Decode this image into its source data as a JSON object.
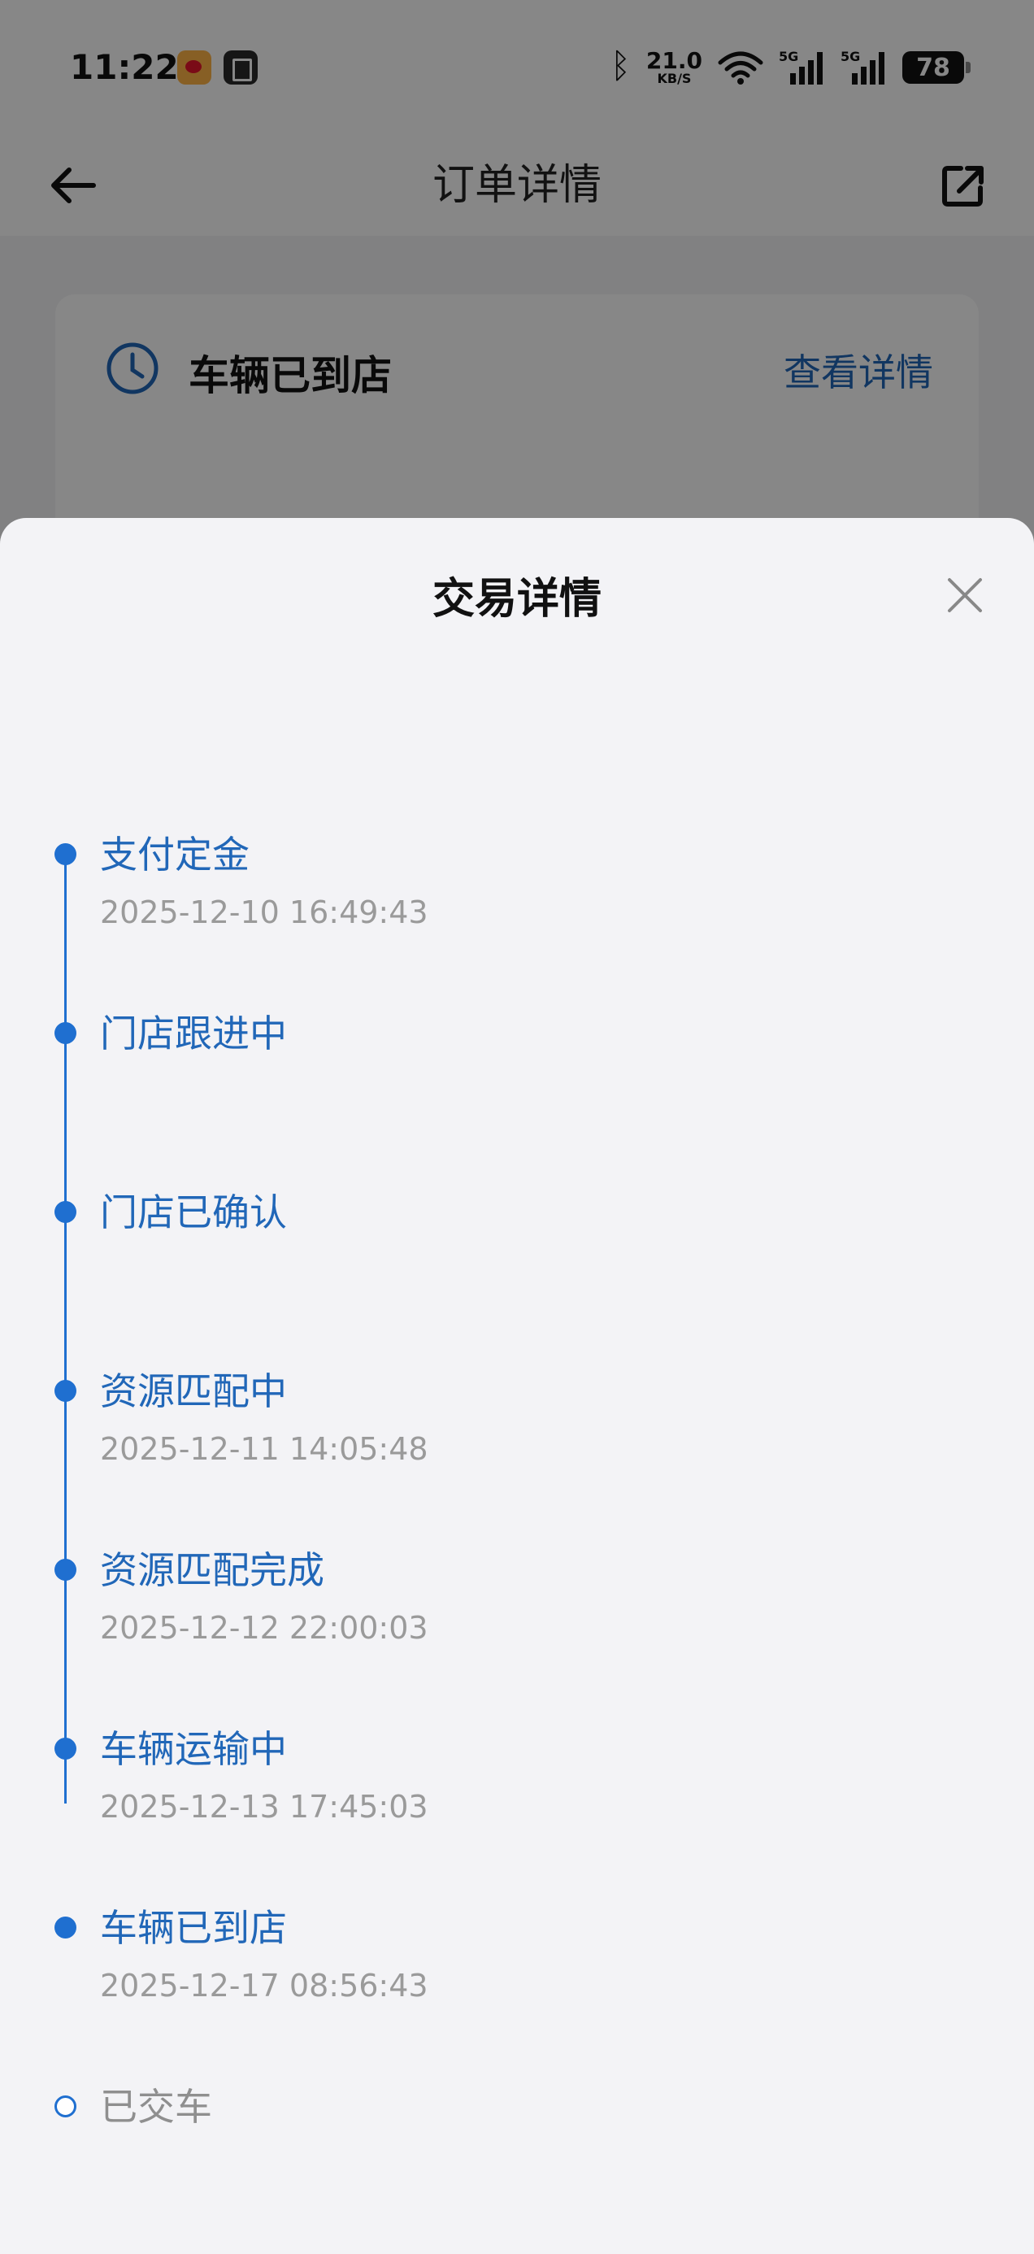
{
  "status_bar": {
    "time": "11:22",
    "net_speed_value": "21.0",
    "net_speed_unit": "KB/S",
    "signal_label_1": "5G",
    "signal_label_2": "5G",
    "battery": "78"
  },
  "nav": {
    "title": "订单详情"
  },
  "order_card": {
    "status": "车辆已到店",
    "view_detail_label": "查看详情"
  },
  "sheet": {
    "title": "交易详情",
    "timeline": [
      {
        "title": "支付定金",
        "time": "2025-12-10 16:49:43",
        "done": true
      },
      {
        "title": "门店跟进中",
        "time": "",
        "done": true
      },
      {
        "title": "门店已确认",
        "time": "",
        "done": true
      },
      {
        "title": "资源匹配中",
        "time": "2025-12-11 14:05:48",
        "done": true
      },
      {
        "title": "资源匹配完成",
        "time": "2025-12-12 22:00:03",
        "done": true
      },
      {
        "title": "车辆运输中",
        "time": "2025-12-13 17:45:03",
        "done": true
      },
      {
        "title": "车辆已到店",
        "time": "2025-12-17 08:56:43",
        "done": true
      },
      {
        "title": "已交车",
        "time": "",
        "done": false
      }
    ]
  },
  "colors": {
    "accent": "#1f6fd0",
    "link": "#2167b8",
    "muted": "#9a9a9a",
    "sheet_bg": "#f3f3f6"
  }
}
